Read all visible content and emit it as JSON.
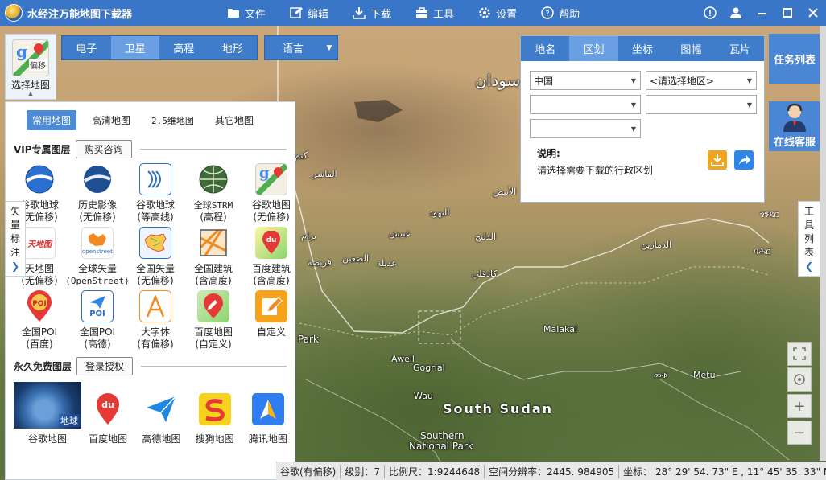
{
  "app": {
    "title": "水经注万能地图下载器"
  },
  "menu": [
    {
      "label": "文件",
      "icon": "folder-icon"
    },
    {
      "label": "编辑",
      "icon": "edit-icon"
    },
    {
      "label": "下载",
      "icon": "download-icon"
    },
    {
      "label": "工具",
      "icon": "toolbox-icon"
    },
    {
      "label": "设置",
      "icon": "gear-icon"
    },
    {
      "label": "帮助",
      "icon": "help-icon"
    }
  ],
  "map_selector": {
    "label": "选择地图",
    "badge": "偏移"
  },
  "map_types": [
    "电子",
    "卫星",
    "高程",
    "地形"
  ],
  "map_types_active": "卫星",
  "language": {
    "label": "语言"
  },
  "layer_panel": {
    "tabs": [
      "常用地图",
      "高清地图",
      "2.5维地图",
      "其它地图"
    ],
    "active_tab": "常用地图",
    "vip": {
      "title": "VIP专属图层",
      "button": "购买咨询",
      "items": [
        {
          "l1": "谷歌地球",
          "l2": "(无偏移)"
        },
        {
          "l1": "历史影像",
          "l2": "(无偏移)"
        },
        {
          "l1": "谷歌地球",
          "l2": "(等高线)"
        },
        {
          "l1": "全球STRM",
          "l2": "(高程)"
        },
        {
          "l1": "谷歌地图",
          "l2": "(无偏移)"
        },
        {
          "l1": "天地图",
          "l2": "(无偏移)"
        },
        {
          "l1": "全球矢量",
          "l2": "(OpenStreet)"
        },
        {
          "l1": "全国矢量",
          "l2": "(无偏移)"
        },
        {
          "l1": "全国建筑",
          "l2": "(含高度)"
        },
        {
          "l1": "百度建筑",
          "l2": "(含高度)"
        },
        {
          "l1": "全国POI",
          "l2": "(百度)"
        },
        {
          "l1": "全国POI",
          "l2": "(高德)"
        },
        {
          "l1": "大字体",
          "l2": "(有偏移)"
        },
        {
          "l1": "百度地图",
          "l2": "(自定义)"
        },
        {
          "l1": "自定义",
          "l2": ""
        }
      ],
      "icon_text": {
        "tianditu": "天地图",
        "openstreet": "openstreet",
        "poi": "POI",
        "du": "du"
      }
    },
    "free": {
      "title": "永久免费图层",
      "button": "登录授权",
      "earth_badge": "地球",
      "items": [
        "谷歌地图",
        "百度地图",
        "高德地图",
        "搜狗地图",
        "腾讯地图"
      ]
    }
  },
  "vector_tab": {
    "chars": [
      "矢",
      "量",
      "标",
      "注"
    ]
  },
  "tool_tab": {
    "chars": [
      "工",
      "具",
      "列",
      "表"
    ]
  },
  "region_panel": {
    "tabs": [
      "地名",
      "区划",
      "坐标",
      "图幅",
      "瓦片"
    ],
    "active_tab": "区划",
    "selects": [
      [
        "中国",
        "<请选择地区>"
      ],
      [
        "",
        ""
      ],
      [
        ""
      ]
    ],
    "note_title": "说明:",
    "note_body": "请选择需要下载的行政区划"
  },
  "side_buttons": {
    "tasks": "任务列表",
    "service": "在线客服"
  },
  "map_labels": [
    {
      "text": "سودان",
      "cls": "huge"
    },
    {
      "text": "South Sudan",
      "cls": "big"
    },
    {
      "text": "Southern",
      "cls": "med"
    },
    {
      "text": "National Park",
      "cls": "med"
    },
    {
      "text": "Malakal",
      "cls": ""
    },
    {
      "text": "Aweil",
      "cls": ""
    },
    {
      "text": "Gogrial",
      "cls": ""
    },
    {
      "text": "Wau",
      "cls": ""
    },
    {
      "text": "Metu",
      "cls": ""
    },
    {
      "text": "Park",
      "cls": "med"
    },
    {
      "text": "الأبيض",
      "cls": ""
    },
    {
      "text": "النهود",
      "cls": ""
    },
    {
      "text": "غبيش",
      "cls": ""
    },
    {
      "text": "الدلنج",
      "cls": ""
    },
    {
      "text": "الضعين",
      "cls": ""
    },
    {
      "text": "عديلة",
      "cls": ""
    },
    {
      "text": "قريضة",
      "cls": ""
    },
    {
      "text": "كادقلي",
      "cls": ""
    },
    {
      "text": "الفاشر",
      "cls": ""
    },
    {
      "text": "كتم",
      "cls": ""
    },
    {
      "text": "برام",
      "cls": ""
    },
    {
      "text": "الدمازين",
      "cls": ""
    },
    {
      "text": "ጎንደር",
      "cls": ""
    },
    {
      "text": "ባሕር",
      "cls": ""
    },
    {
      "text": "መቱ",
      "cls": ""
    }
  ],
  "status": {
    "layer": "谷歌(有偏移)",
    "level": "级别：7",
    "scale": "比例尺：1:9244648",
    "resolution": "空间分辨率：2445. 984905",
    "coords": "坐标： 28° 29' 54. 73\" E , 11° 45' 35. 33\" N"
  }
}
